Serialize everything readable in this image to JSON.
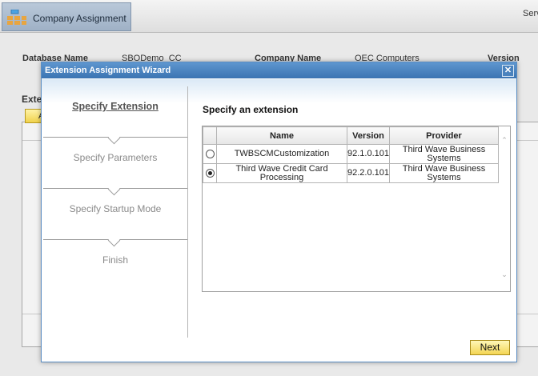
{
  "app": {
    "tab_label": "Company Assignment",
    "top_right": "Serv",
    "database_label": "Database Name",
    "database_value": "SBODemo_CC",
    "company_label": "Company Name",
    "company_value": "OEC Computers",
    "version_label": "Version",
    "section_label": "Exte",
    "section_button": "A"
  },
  "dialog": {
    "title": "Extension Assignment Wizard",
    "close_glyph": "✕",
    "steps": [
      {
        "label": "Specify Extension",
        "active": true
      },
      {
        "label": "Specify Parameters",
        "active": false
      },
      {
        "label": "Specify Startup Mode",
        "active": false
      },
      {
        "label": "Finish",
        "active": false
      }
    ],
    "content_title": "Specify an extension",
    "grid": {
      "columns": [
        "Name",
        "Version",
        "Provider"
      ],
      "rows": [
        {
          "selected": false,
          "name": "TWBSCMCustomization",
          "version": "92.1.0.101",
          "provider": "Third Wave Business Systems"
        },
        {
          "selected": true,
          "name": "Third Wave Credit Card Processing",
          "version": "92.2.0.101",
          "provider": "Third Wave Business Systems"
        }
      ]
    },
    "next_label": "Next"
  }
}
